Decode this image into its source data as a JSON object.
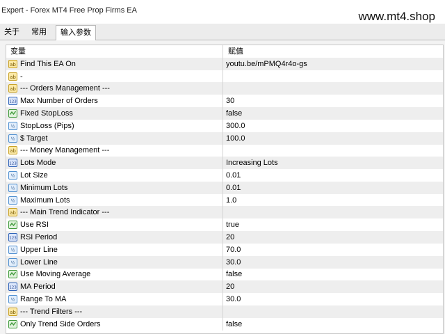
{
  "window": {
    "title": "Expert - Forex MT4 Free Prop Firms EA",
    "watermark": "www.mt4.shop"
  },
  "tabs": [
    {
      "label": "关于"
    },
    {
      "label": "常用"
    },
    {
      "label": "输入参数",
      "active": true
    }
  ],
  "table": {
    "headers": {
      "name": "变量",
      "value": "赋值"
    },
    "rows": [
      {
        "icon": "string-icon",
        "name": "Find This EA On",
        "value": "youtu.be/mPMQ4r4o-gs"
      },
      {
        "icon": "string-icon",
        "name": "-",
        "value": ""
      },
      {
        "icon": "string-icon",
        "name": "--- Orders Management ---",
        "value": ""
      },
      {
        "icon": "integer-icon",
        "name": "Max Number of Orders",
        "value": "30"
      },
      {
        "icon": "boolean-icon",
        "name": "Fixed StopLoss",
        "value": "false"
      },
      {
        "icon": "double-icon",
        "name": "StopLoss (Pips)",
        "value": "300.0"
      },
      {
        "icon": "double-icon",
        "name": "$ Target",
        "value": "100.0"
      },
      {
        "icon": "string-icon",
        "name": "--- Money Management ---",
        "value": ""
      },
      {
        "icon": "integer-icon",
        "name": "Lots Mode",
        "value": "Increasing Lots"
      },
      {
        "icon": "double-icon",
        "name": "Lot Size",
        "value": "0.01"
      },
      {
        "icon": "double-icon",
        "name": "Minimum Lots",
        "value": "0.01"
      },
      {
        "icon": "double-icon",
        "name": "Maximum Lots",
        "value": "1.0"
      },
      {
        "icon": "string-icon",
        "name": "--- Main Trend Indicator ---",
        "value": ""
      },
      {
        "icon": "boolean-icon",
        "name": "Use RSI",
        "value": "true"
      },
      {
        "icon": "integer-icon",
        "name": "RSI Period",
        "value": "20"
      },
      {
        "icon": "double-icon",
        "name": "Upper Line",
        "value": "70.0"
      },
      {
        "icon": "double-icon",
        "name": "Lower Line",
        "value": "30.0"
      },
      {
        "icon": "boolean-icon",
        "name": "Use Moving Average",
        "value": "false"
      },
      {
        "icon": "integer-icon",
        "name": "MA Period",
        "value": "20"
      },
      {
        "icon": "double-icon",
        "name": "Range To MA",
        "value": "30.0"
      },
      {
        "icon": "string-icon",
        "name": "--- Trend Filters ---",
        "value": ""
      },
      {
        "icon": "boolean-icon",
        "name": "Only Trend Side Orders",
        "value": "false"
      }
    ]
  },
  "colors": {
    "string_icon": "#c9a227",
    "integer_icon": "#2f63b8",
    "boolean_icon": "#3f9a3a",
    "double_icon": "#4f8fd0",
    "row_alt": "#eeeeee",
    "grid_line": "#d4d4d4"
  }
}
